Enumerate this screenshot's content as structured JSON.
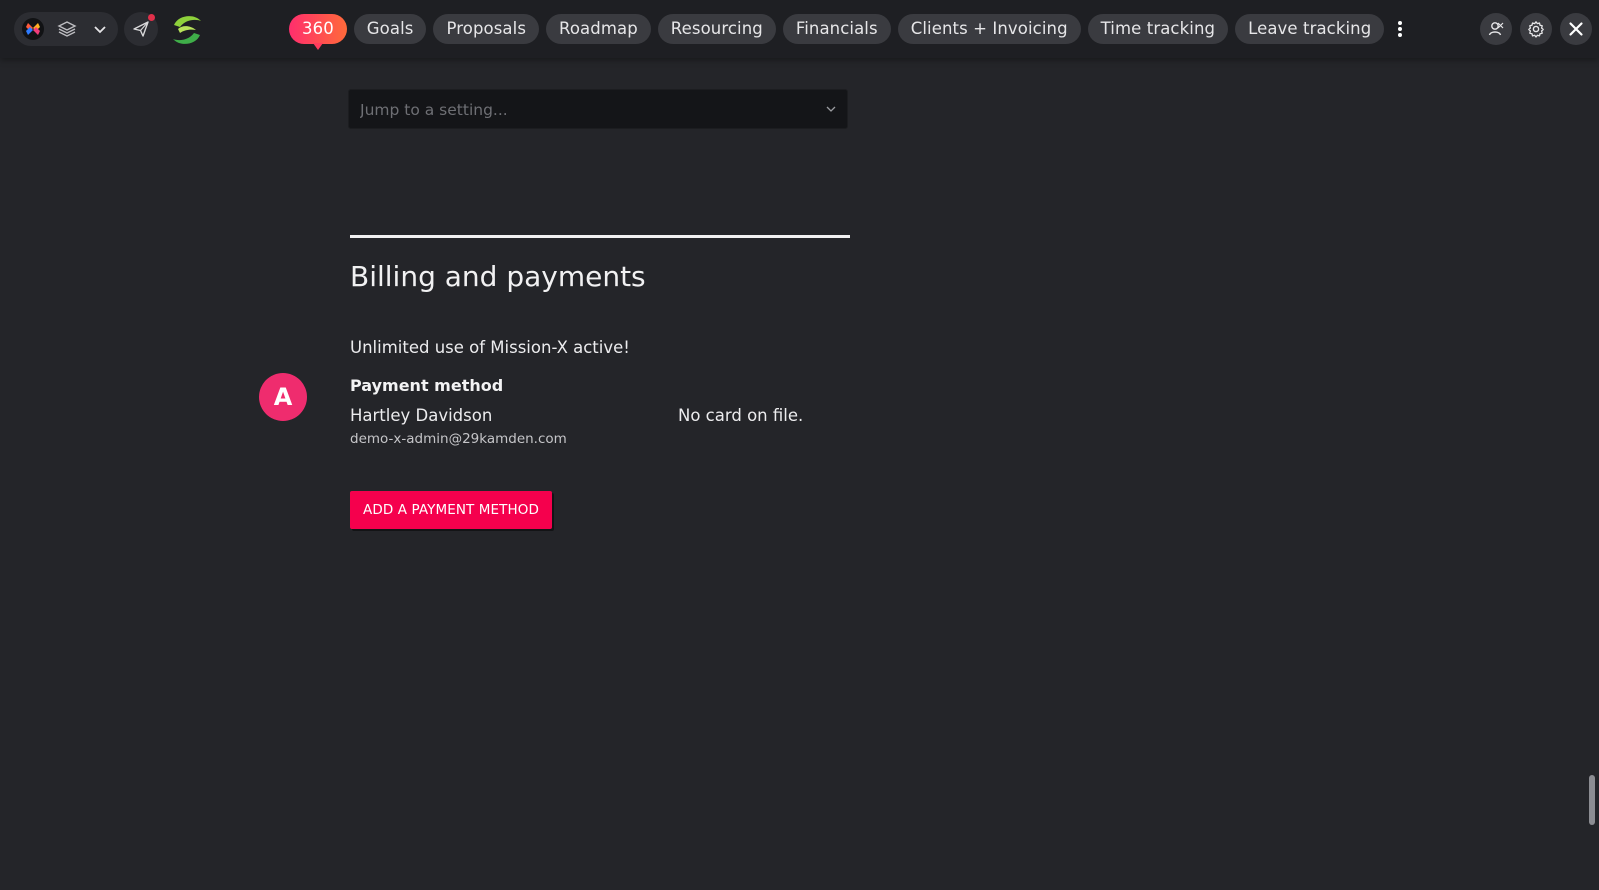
{
  "nav": {
    "tabs": [
      {
        "label": "360",
        "active": true
      },
      {
        "label": "Goals"
      },
      {
        "label": "Proposals"
      },
      {
        "label": "Roadmap"
      },
      {
        "label": "Resourcing"
      },
      {
        "label": "Financials"
      },
      {
        "label": "Clients + Invoicing"
      },
      {
        "label": "Time tracking"
      },
      {
        "label": "Leave tracking"
      }
    ],
    "accent_gradient": [
      "#ff2e6d",
      "#ff6a3a"
    ]
  },
  "toolbar": {
    "icons": [
      "mission-x-logo-icon",
      "layers-icon",
      "chevron-down-icon",
      "send-icon",
      "brand-logo-icon",
      "more-vertical-icon",
      "user-switch-icon",
      "gear-icon",
      "close-icon"
    ]
  },
  "search": {
    "placeholder": "Jump to a setting..."
  },
  "billing": {
    "title": "Billing and payments",
    "status": "Unlimited use of Mission-X active!",
    "payment_method_label": "Payment method",
    "avatar_letter": "A",
    "user_name": "Hartley Davidson",
    "user_email": "demo-x-admin@29kamden.com",
    "card_status": "No card on file.",
    "add_button_label": "ADD A PAYMENT METHOD",
    "accent_color": "#f5004d",
    "avatar_color": "#ef2c6e"
  }
}
